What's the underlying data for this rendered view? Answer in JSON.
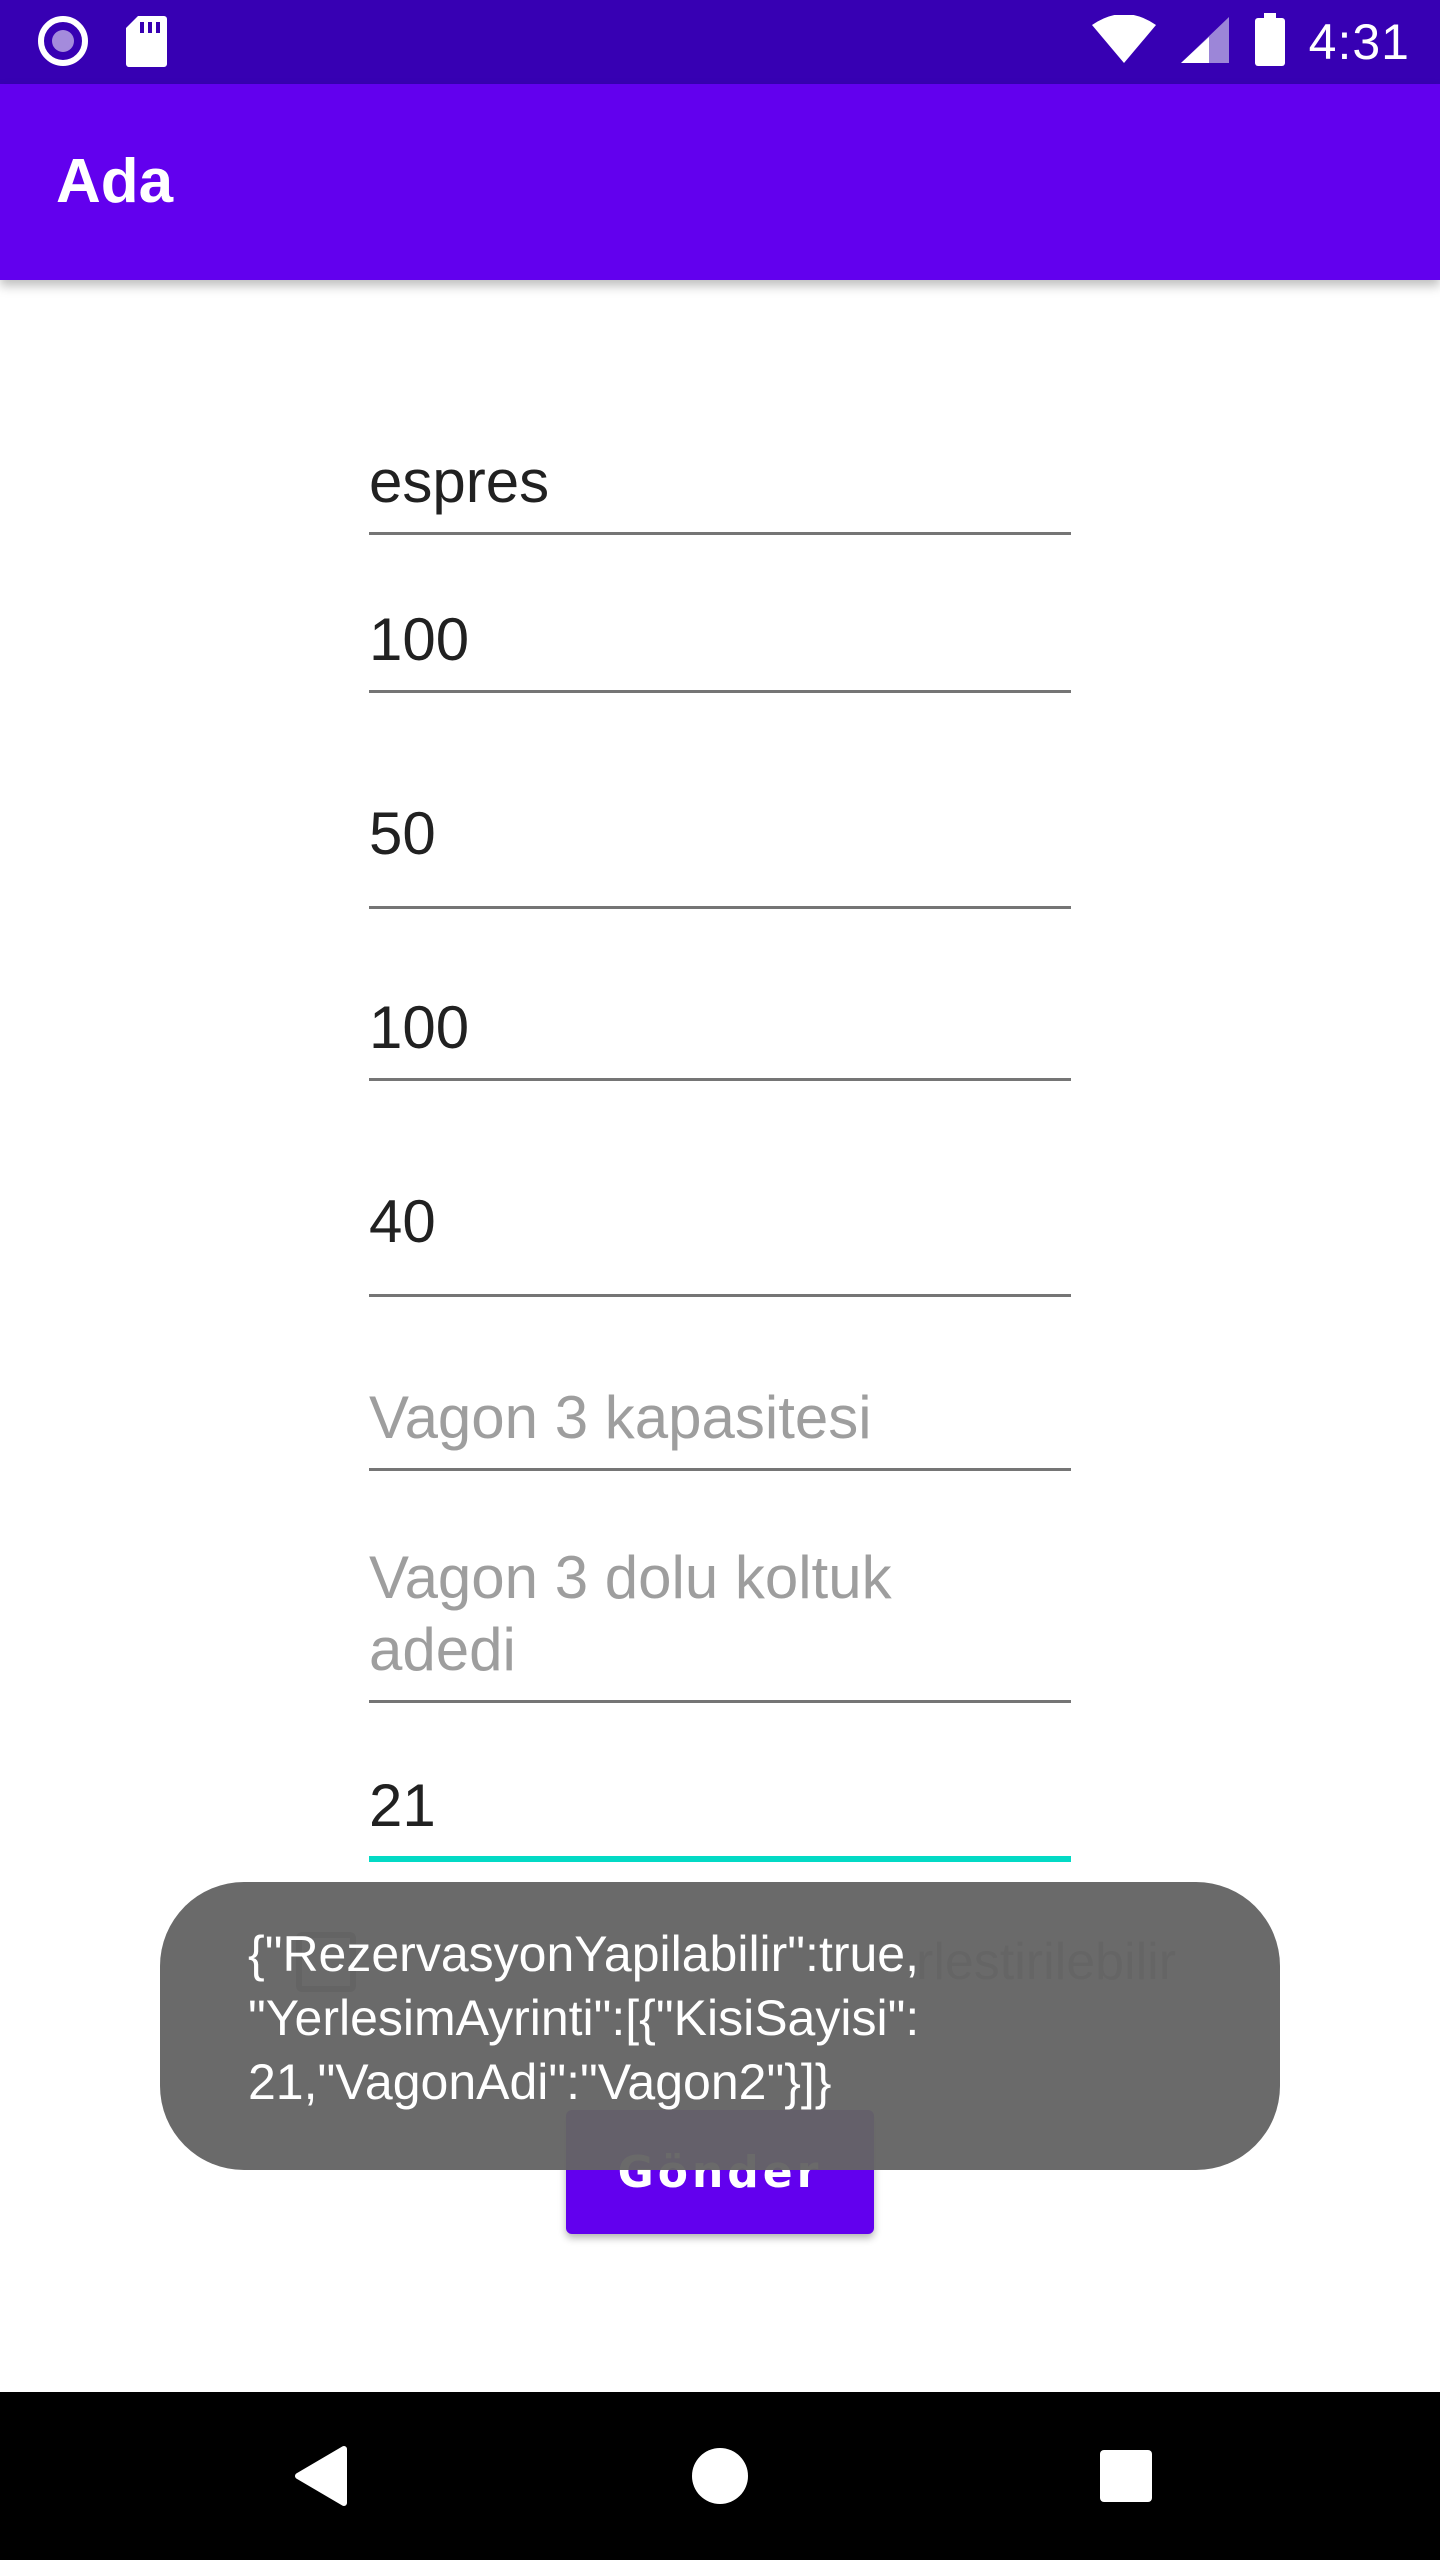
{
  "status_bar": {
    "time": "4:31",
    "left_icons": [
      "notification-circle-icon",
      "sd-card-icon"
    ],
    "right_icons": [
      "wifi-icon",
      "cell-signal-icon",
      "battery-icon"
    ]
  },
  "app_bar": {
    "title": "Ada"
  },
  "form": {
    "fields": [
      {
        "value": "espres",
        "placeholder": ""
      },
      {
        "value": "100",
        "placeholder": ""
      },
      {
        "value": "50",
        "placeholder": ""
      },
      {
        "value": "100",
        "placeholder": ""
      },
      {
        "value": "40",
        "placeholder": ""
      },
      {
        "value": "",
        "placeholder": "Vagon 3 kapasitesi"
      },
      {
        "value": "",
        "placeholder_line1": "Vagon 3 dolu koltuk",
        "placeholder_line2": "adedi"
      },
      {
        "value": "21",
        "placeholder": ""
      }
    ],
    "checkbox_label_visible": "rlestirilebilir",
    "checkbox_checked": false,
    "send_label": "Gönder"
  },
  "toast": {
    "line1": "{\"RezervasyonYapilabilir\":true,",
    "line2": "\"YerlesimAyrinti\":[{\"KisiSayisi\":",
    "line3": "21,\"VagonAdi\":\"Vagon2\"}]}"
  },
  "nav_bar": {
    "icons": [
      "back-icon",
      "home-icon",
      "recents-icon"
    ]
  },
  "colors": {
    "status_bar": "#3700b3",
    "primary": "#6200ee",
    "accent": "#03dac5",
    "toast_bg": "#646464"
  }
}
